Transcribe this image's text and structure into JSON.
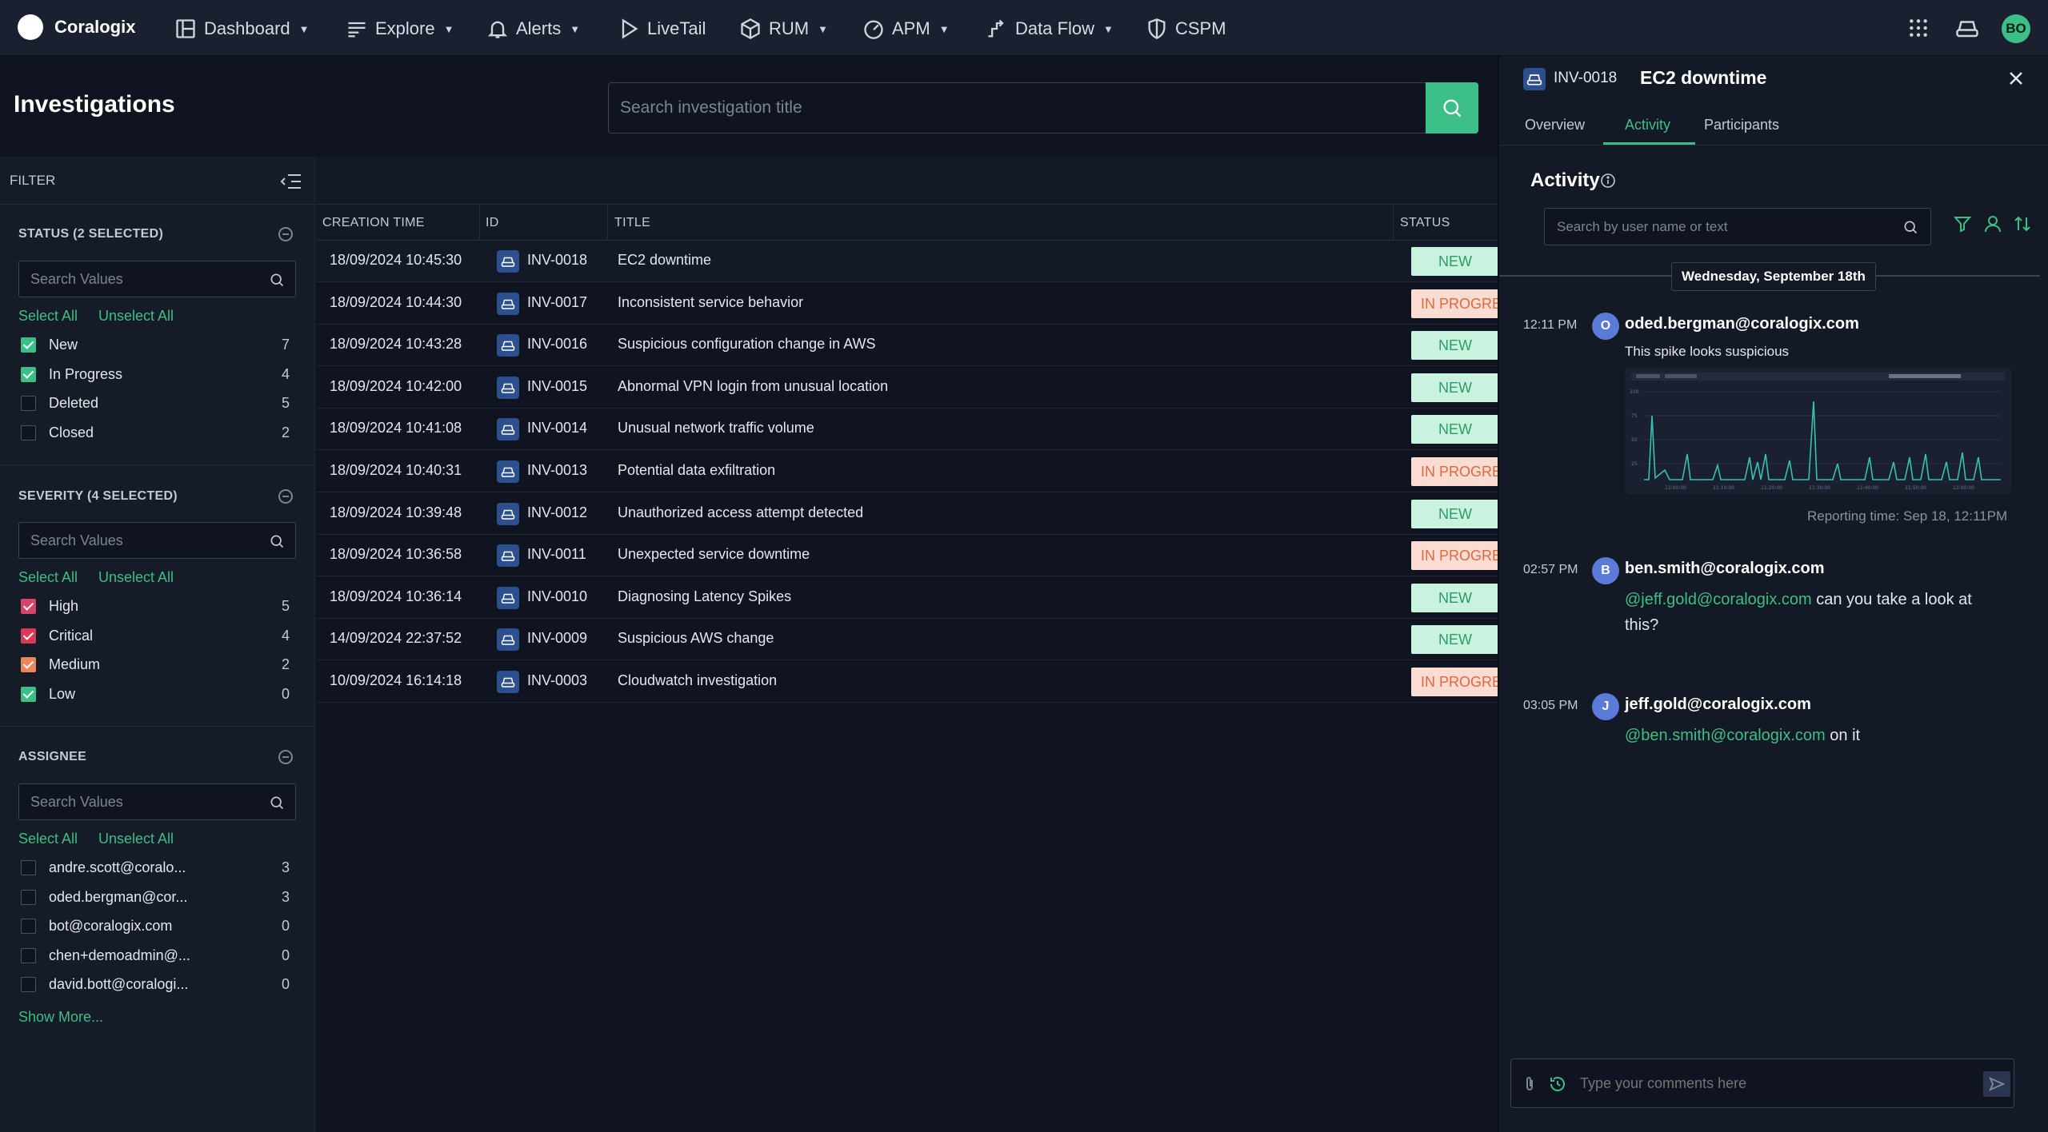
{
  "app": {
    "brand": "Coralogix",
    "avatar_initials": "BO"
  },
  "nav": [
    {
      "label": "Dashboard",
      "icon": "dashboard-icon"
    },
    {
      "label": "Explore",
      "icon": "explore-icon"
    },
    {
      "label": "Alerts",
      "icon": "bell-icon"
    },
    {
      "label": "LiveTail",
      "icon": "play-icon"
    },
    {
      "label": "RUM",
      "icon": "rum-icon"
    },
    {
      "label": "APM",
      "icon": "gauge-icon"
    },
    {
      "label": "Data Flow",
      "icon": "dataflow-icon"
    },
    {
      "label": "CSPM",
      "icon": "shield-icon"
    }
  ],
  "page": {
    "title": "Investigations",
    "search_placeholder": "Search investigation title"
  },
  "filter": {
    "title": "FILTER",
    "select_all": "Select All",
    "unselect_all": "Unselect All",
    "search_placeholder": "Search Values",
    "show_more": "Show More...",
    "status": {
      "title": "STATUS (2 SELECTED)",
      "items": [
        {
          "label": "New",
          "count": "7",
          "checked": true,
          "color": "#3cbf86"
        },
        {
          "label": "In Progress",
          "count": "4",
          "checked": true,
          "color": "#3cbf86"
        },
        {
          "label": "Deleted",
          "count": "5",
          "checked": false
        },
        {
          "label": "Closed",
          "count": "2",
          "checked": false
        }
      ]
    },
    "severity": {
      "title": "SEVERITY (4 SELECTED)",
      "items": [
        {
          "label": "High",
          "count": "5",
          "checked": true,
          "color": "#d8436b"
        },
        {
          "label": "Critical",
          "count": "4",
          "checked": true,
          "color": "#d63a55"
        },
        {
          "label": "Medium",
          "count": "2",
          "checked": true,
          "color": "#e8875a"
        },
        {
          "label": "Low",
          "count": "0",
          "checked": true,
          "color": "#3cbf86"
        }
      ]
    },
    "assignee": {
      "title": "ASSIGNEE",
      "items": [
        {
          "label": "andre.scott@coralo...",
          "count": "3",
          "checked": false
        },
        {
          "label": "oded.bergman@cor...",
          "count": "3",
          "checked": false
        },
        {
          "label": "bot@coralogix.com",
          "count": "0",
          "checked": false
        },
        {
          "label": "chen+demoadmin@...",
          "count": "0",
          "checked": false
        },
        {
          "label": "david.bott@coralogi...",
          "count": "0",
          "checked": false
        }
      ]
    }
  },
  "table": {
    "columns": [
      "CREATION TIME",
      "ID",
      "TITLE",
      "STATUS"
    ],
    "rows": [
      {
        "time": "18/09/2024 10:45:30",
        "id": "INV-0018",
        "title": "EC2 downtime",
        "status": "NEW"
      },
      {
        "time": "18/09/2024 10:44:30",
        "id": "INV-0017",
        "title": "Inconsistent service behavior",
        "status": "IN PROGRESS"
      },
      {
        "time": "18/09/2024 10:43:28",
        "id": "INV-0016",
        "title": "Suspicious configuration change in AWS",
        "status": "NEW"
      },
      {
        "time": "18/09/2024 10:42:00",
        "id": "INV-0015",
        "title": "Abnormal VPN login from unusual location",
        "status": "NEW"
      },
      {
        "time": "18/09/2024 10:41:08",
        "id": "INV-0014",
        "title": "Unusual network traffic volume",
        "status": "NEW"
      },
      {
        "time": "18/09/2024 10:40:31",
        "id": "INV-0013",
        "title": "Potential data exfiltration",
        "status": "IN PROGRESS"
      },
      {
        "time": "18/09/2024 10:39:48",
        "id": "INV-0012",
        "title": "Unauthorized access attempt detected",
        "status": "NEW"
      },
      {
        "time": "18/09/2024 10:36:58",
        "id": "INV-0011",
        "title": "Unexpected service downtime",
        "status": "IN PROGRESS"
      },
      {
        "time": "18/09/2024 10:36:14",
        "id": "INV-0010",
        "title": "Diagnosing Latency Spikes",
        "status": "NEW"
      },
      {
        "time": "14/09/2024 22:37:52",
        "id": "INV-0009",
        "title": "Suspicious AWS change",
        "status": "NEW"
      },
      {
        "time": "10/09/2024 16:14:18",
        "id": "INV-0003",
        "title": "Cloudwatch investigation",
        "status": "IN PROGRESS"
      }
    ]
  },
  "panel": {
    "inv_id": "INV-0018",
    "title": "EC2 downtime",
    "tabs": [
      "Overview",
      "Activity",
      "Participants"
    ],
    "activity_title": "Activity",
    "search_placeholder": "Search by user name or text",
    "date_divider": "Wednesday, September 18th",
    "messages": [
      {
        "time": "12:11 PM",
        "initial": "O",
        "user": "oded.bergman@coralogix.com",
        "text": "This spike looks suspicious",
        "reporting": "Reporting time: Sep 18, 12:11PM"
      },
      {
        "time": "02:57 PM",
        "initial": "B",
        "user": "ben.smith@coralogix.com",
        "mention": "@jeff.gold@coralogix.com",
        "text1": " can you take a look at",
        "text2": "this?"
      },
      {
        "time": "03:05 PM",
        "initial": "J",
        "user": "jeff.gold@coralogix.com",
        "mention": "@ben.smith@coralogix.com",
        "text1": " on it"
      }
    ],
    "comment_placeholder": "Type your comments here"
  }
}
